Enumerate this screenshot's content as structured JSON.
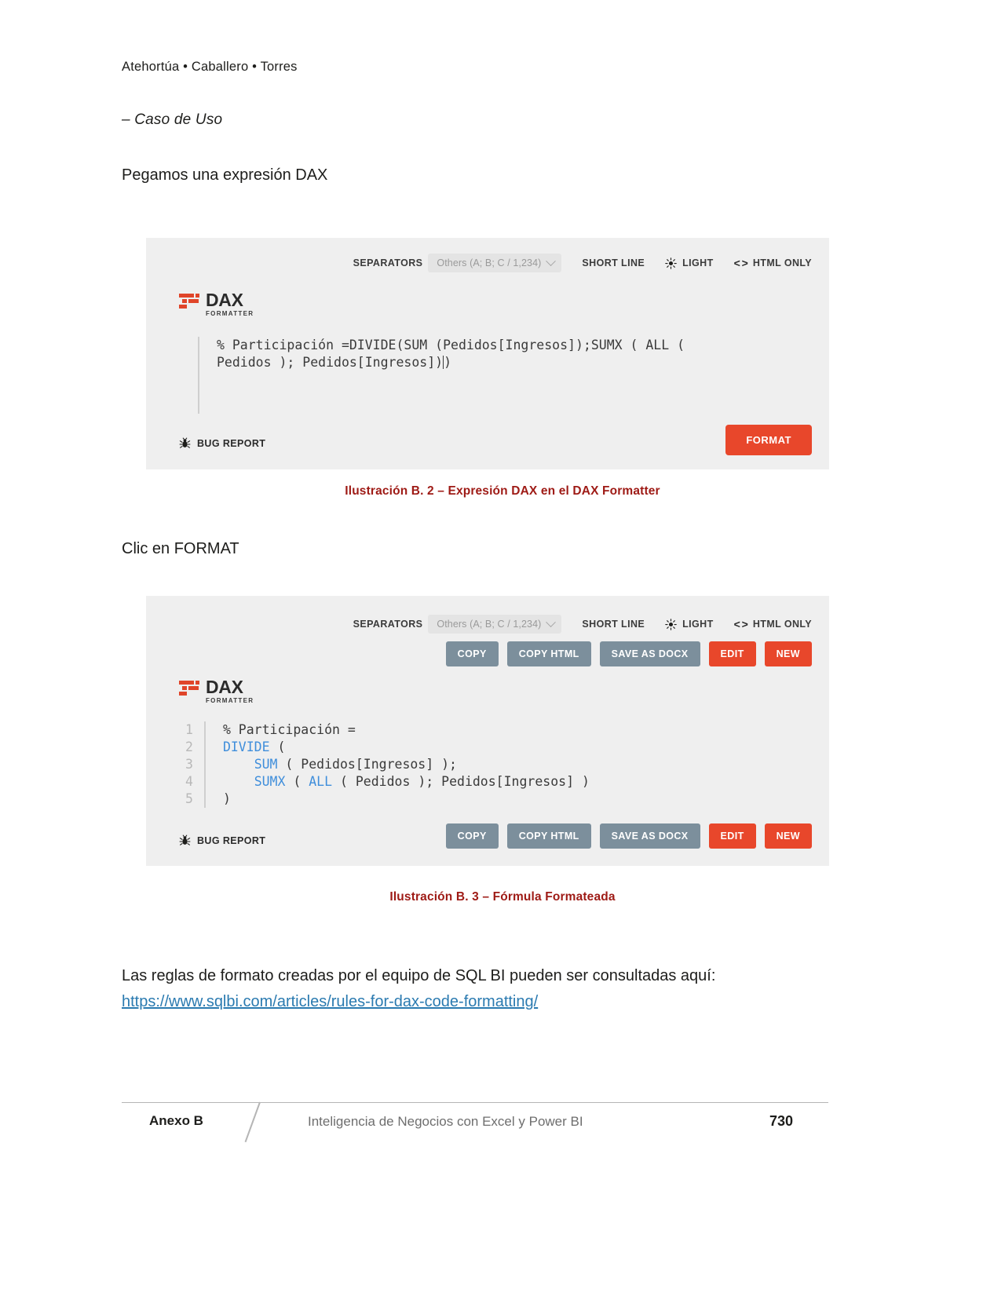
{
  "document": {
    "running_head": "Atehortúa • Caballero • Torres",
    "section_heading": "– Caso de Uso",
    "paragraph_1": "Pegamos una expresión DAX",
    "paragraph_2": "Clic en FORMAT",
    "paragraph_3": "Las reglas de formato creadas por el equipo de SQL BI pueden ser consultadas aquí:",
    "link": "https://www.sqlbi.com/articles/rules-for-dax-code-formatting/",
    "caption_1": "Ilustración B. 2 – Expresión DAX en el DAX Formatter",
    "caption_2": "Ilustración B. 3 – Fórmula Formateada"
  },
  "footer": {
    "left": "Anexo B",
    "center": "Inteligencia de Negocios con Excel y Power BI",
    "page_number": "730"
  },
  "figure_1": {
    "logo": {
      "name": "DAX",
      "subtitle": "FORMATTER"
    },
    "toolbar": {
      "separators_label": "SEPARATORS",
      "separators_value": "Others (A; B; C / 1,234)",
      "short_line": "SHORT LINE",
      "theme": "LIGHT",
      "html_only": "HTML ONLY",
      "code_icon": "< >"
    },
    "code_lines": [
      "% Participación =DIVIDE(SUM (Pedidos[Ingresos]);SUMX ( ALL (",
      "Pedidos ); Pedidos[Ingresos])"
    ],
    "bug_report": "BUG REPORT",
    "format_button": "FORMAT"
  },
  "figure_2": {
    "logo": {
      "name": "DAX",
      "subtitle": "FORMATTER"
    },
    "toolbar": {
      "separators_label": "SEPARATORS",
      "separators_value": "Others (A; B; C / 1,234)",
      "short_line": "SHORT LINE",
      "theme": "LIGHT",
      "html_only": "HTML ONLY",
      "code_icon": "< >"
    },
    "buttons": {
      "copy": "COPY",
      "copy_html": "COPY HTML",
      "save_as_docx": "SAVE AS DOCX",
      "edit": "EDIT",
      "new": "NEW"
    },
    "line_numbers": "1\n2\n3\n4\n5",
    "code": {
      "line1": "% Participación =",
      "line2_kw": "DIVIDE",
      "line2_rest": " (",
      "line3_indent": "    ",
      "line3_kw": "SUM",
      "line3_rest": " ( Pedidos[Ingresos] );",
      "line4_indent": "    ",
      "line4_kw1": "SUMX",
      "line4_mid": " ( ",
      "line4_kw2": "ALL",
      "line4_rest": " ( Pedidos ); Pedidos[Ingresos] )",
      "line5": ")"
    },
    "bug_report": "BUG REPORT"
  },
  "colors": {
    "accent_red": "#e8472b",
    "button_gray": "#7c8f9c",
    "caption_red": "#9e1a15",
    "link_blue": "#2a7ab0",
    "keyword_blue": "#3f8edb"
  }
}
